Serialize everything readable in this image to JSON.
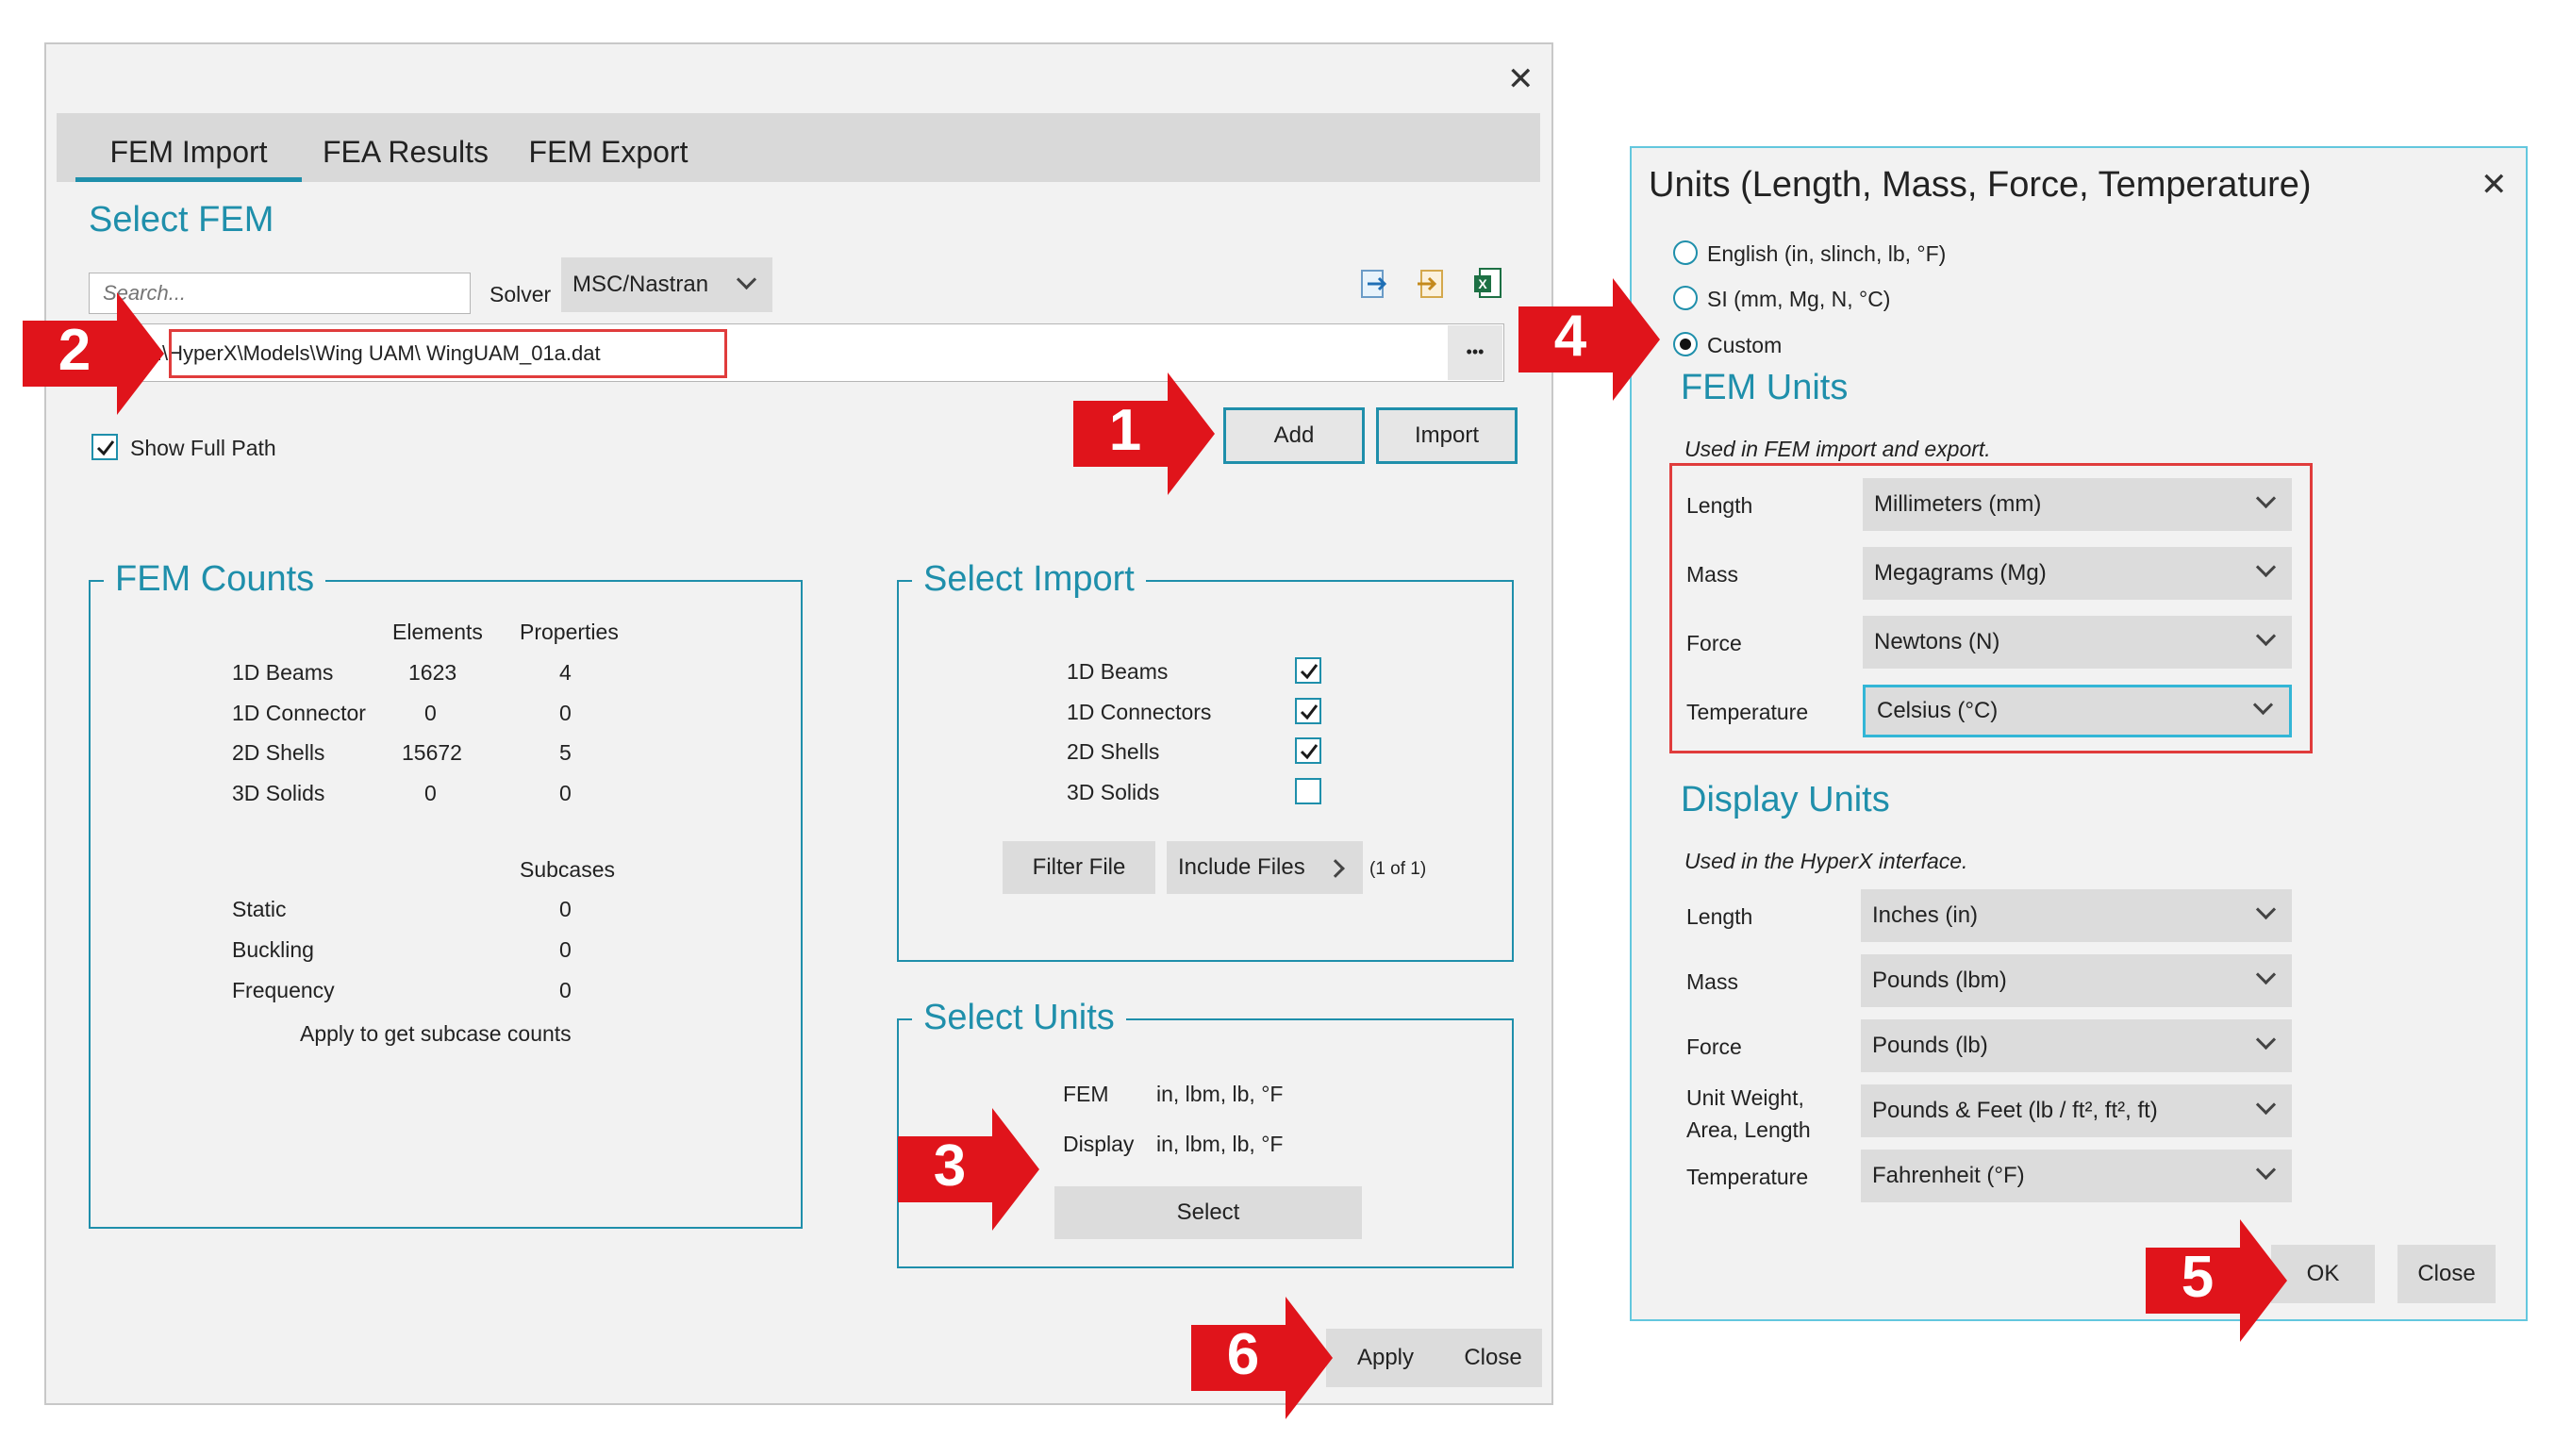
{
  "left_dialog": {
    "tabs": [
      "FEM Import",
      "FEA Results",
      "FEM Export"
    ],
    "section_title": "Select FEM",
    "search_placeholder": "Search...",
    "solver_label": "Solver",
    "solver_value": "MSC/Nastran",
    "file_path": "C:\\HyperX\\Models\\Wing UAM\\  WingUAM_01a.dat",
    "browse_label": "•••",
    "add_label": "Add",
    "import_label": "Import",
    "show_full_path_label": "Show Full Path",
    "show_full_path_checked": true,
    "fem_counts": {
      "title": "FEM Counts",
      "col_elements": "Elements",
      "col_properties": "Properties",
      "rows": [
        {
          "name": "1D Beams",
          "elements": "1623",
          "properties": "4"
        },
        {
          "name": "1D Connector",
          "elements": "0",
          "properties": "0"
        },
        {
          "name": "2D Shells",
          "elements": "15672",
          "properties": "5"
        },
        {
          "name": "3D Solids",
          "elements": "0",
          "properties": "0"
        }
      ],
      "subcases_header": "Subcases",
      "subcases": [
        {
          "name": "Static",
          "count": "0"
        },
        {
          "name": "Buckling",
          "count": "0"
        },
        {
          "name": "Frequency",
          "count": "0"
        }
      ],
      "note": "Apply to get subcase counts"
    },
    "select_import": {
      "title": "Select Import",
      "items": [
        {
          "label": "1D Beams",
          "checked": true
        },
        {
          "label": "1D Connectors",
          "checked": true
        },
        {
          "label": "2D Shells",
          "checked": true
        },
        {
          "label": "3D Solids",
          "checked": false
        }
      ],
      "filter_file_label": "Filter File",
      "include_files_label": "Include Files",
      "include_count": "(1 of 1)"
    },
    "select_units": {
      "title": "Select Units",
      "fem_label": "FEM",
      "fem_value": "in, lbm, lb, °F",
      "display_label": "Display",
      "display_value": "in, lbm, lb, °F",
      "select_label": "Select"
    },
    "apply_label": "Apply",
    "close_label": "Close"
  },
  "units_dialog": {
    "title": "Units (Length, Mass, Force, Temperature)",
    "options": [
      {
        "label": "English (in, slinch, lb, °F)",
        "selected": false
      },
      {
        "label": "SI (mm, Mg, N, °C)",
        "selected": false
      },
      {
        "label": "Custom",
        "selected": true
      }
    ],
    "fem_units": {
      "title": "FEM Units",
      "note": "Used in FEM import and export.",
      "rows": [
        {
          "label": "Length",
          "value": "Millimeters (mm)"
        },
        {
          "label": "Mass",
          "value": "Megagrams (Mg)"
        },
        {
          "label": "Force",
          "value": "Newtons (N)"
        },
        {
          "label": "Temperature",
          "value": "Celsius (°C)"
        }
      ]
    },
    "display_units": {
      "title": "Display Units",
      "note": "Used in the HyperX interface.",
      "rows": [
        {
          "label": "Length",
          "value": "Inches (in)"
        },
        {
          "label": "Mass",
          "value": "Pounds (lbm)"
        },
        {
          "label": "Force",
          "value": "Pounds (lb)"
        },
        {
          "label": "Unit Weight,",
          "label2": "Area, Length",
          "value": "Pounds & Feet (lb / ft², ft², ft)"
        },
        {
          "label": "Temperature",
          "value": "Fahrenheit (°F)"
        }
      ]
    },
    "ok_label": "OK",
    "close_label": "Close"
  },
  "callouts": [
    "1",
    "2",
    "3",
    "4",
    "5",
    "6"
  ],
  "colors": {
    "accent": "#1f8fab",
    "callout": "#e0141b",
    "highlight": "#e03c3c"
  }
}
